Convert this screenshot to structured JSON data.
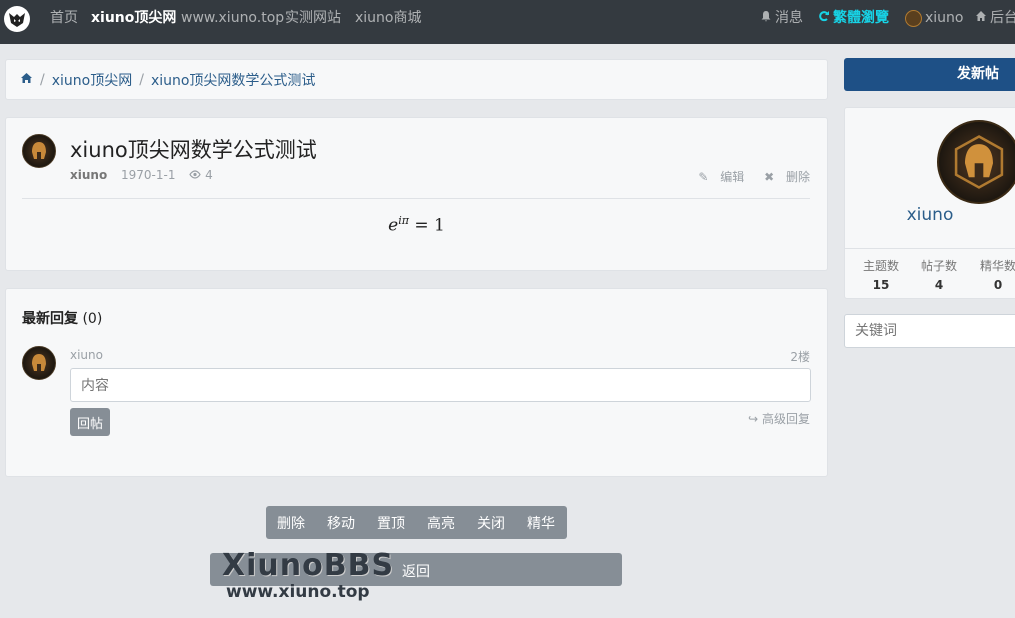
{
  "nav": {
    "items": [
      "首页",
      "xiuno顶尖网",
      "www.xiuno.top",
      "实测网站",
      "xiuno商城"
    ],
    "message": "消息",
    "traditional": "繁體瀏覽",
    "user": "xiuno",
    "admin": "后台"
  },
  "breadcrumb": [
    "xiuno顶尖网",
    "xiuno顶尖网数学公式测试"
  ],
  "thread": {
    "title": "xiuno顶尖网数学公式测试",
    "user": "xiuno",
    "date": "1970-1-1",
    "views": "4",
    "edit": "编辑",
    "delete": "删除",
    "formula_base": "e",
    "formula_exp": "iπ",
    "formula_rest": "= 1"
  },
  "replies": {
    "heading": "最新回复",
    "count": "(0)",
    "user": "xiuno",
    "floor": "2楼",
    "placeholder": "内容",
    "submit": "回帖",
    "advanced": "高级回复"
  },
  "mod_actions": [
    "删除",
    "移动",
    "置顶",
    "高亮",
    "关闭",
    "精华"
  ],
  "back": "返回",
  "watermark": {
    "brand": "XiunoBBS",
    "url": "www.xiuno.top"
  },
  "sidebar": {
    "new_post": "发新帖",
    "profile_name": "xiuno",
    "stats": [
      {
        "label": "主题数",
        "value": "15"
      },
      {
        "label": "帖子数",
        "value": "4"
      },
      {
        "label": "精华数",
        "value": "0"
      }
    ],
    "keyword_placeholder": "关键词"
  },
  "colors": {
    "navbar": "#343a40",
    "accent": "#1e5086",
    "link": "#2b5d8a",
    "cyan": "#17d3e6"
  }
}
